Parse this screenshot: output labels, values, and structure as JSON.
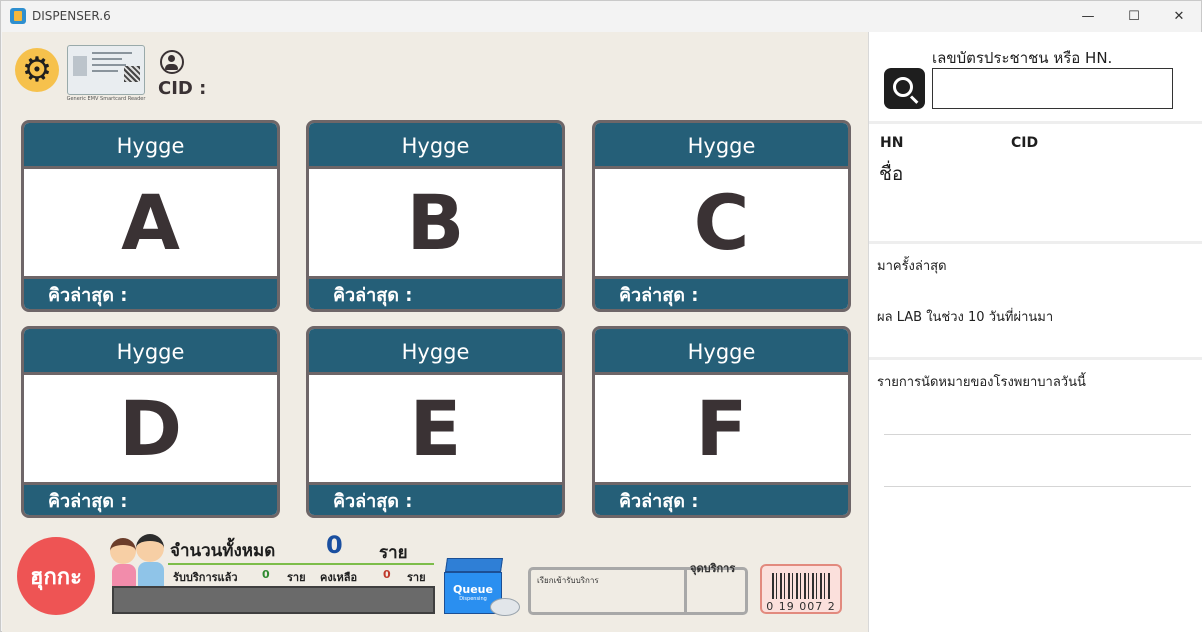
{
  "window": {
    "title": "DISPENSER.6",
    "minimize": "—",
    "maximize": "☐",
    "close": "✕"
  },
  "header": {
    "card_reader_caption": "Generic EMV Smartcard Reader",
    "cid_label": "CID :"
  },
  "counters": [
    {
      "name": "Hygge",
      "letter": "A",
      "last_queue_label": "คิวล่าสุด :"
    },
    {
      "name": "Hygge",
      "letter": "B",
      "last_queue_label": "คิวล่าสุด :"
    },
    {
      "name": "Hygge",
      "letter": "C",
      "last_queue_label": "คิวล่าสุด :"
    },
    {
      "name": "Hygge",
      "letter": "D",
      "last_queue_label": "คิวล่าสุด :"
    },
    {
      "name": "Hygge",
      "letter": "E",
      "last_queue_label": "คิวล่าสุด :"
    },
    {
      "name": "Hygge",
      "letter": "F",
      "last_queue_label": "คิวล่าสุด :"
    }
  ],
  "footer": {
    "logo_text": "ฮุกกะ",
    "total_label": "จำนวนทั้งหมด",
    "total_value": "0",
    "total_unit": "ราย",
    "served_label": "รับบริการแล้ว",
    "served_value": "0",
    "served_unit": "ราย",
    "remaining_label": "คงเหลือ",
    "remaining_value": "0",
    "remaining_unit": "ราย",
    "queue_title": "Queue",
    "queue_sub": "Dispensing",
    "call_label": "เรียกเข้ารับบริการ",
    "service_point_label": "จุดบริการ",
    "barcode_number": "0 19 007 2"
  },
  "sidebar": {
    "search_label": "เลขบัตรประชาชน หรือ HN.",
    "search_value": "",
    "hn_label": "HN",
    "cid_label": "CID",
    "name_label": "ชื่อ",
    "last_visit_label": "มาครั้งล่าสุด",
    "lab_label": "ผล LAB ในช่วง 10 วันที่ผ่านมา",
    "appointment_label": "รายการนัดหมายของโรงพยาบาลวันนี้"
  },
  "colors": {
    "counter_header": "#255f78",
    "panel_bg": "#f0ece4",
    "logo_red": "#ee5454",
    "gear_yellow": "#f6c14c"
  }
}
